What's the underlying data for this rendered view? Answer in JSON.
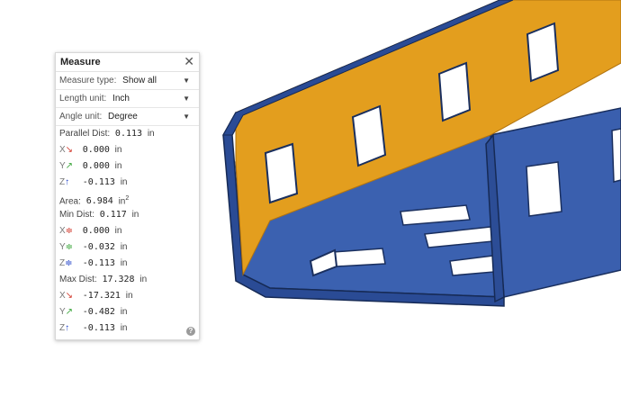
{
  "panel": {
    "title": "Measure",
    "close_icon": "close-icon",
    "measure_type": {
      "label": "Measure type:",
      "value": "Show all"
    },
    "length_unit": {
      "label": "Length unit:",
      "value": "Inch"
    },
    "angle_unit": {
      "label": "Angle unit:",
      "value": "Degree"
    },
    "parallel": {
      "label": "Parallel Dist:",
      "value": "0.113",
      "unit": "in",
      "x": {
        "axis": "X",
        "value": "0.000",
        "unit": "in"
      },
      "y": {
        "axis": "Y",
        "value": "0.000",
        "unit": "in"
      },
      "z": {
        "axis": "Z",
        "value": "-0.113",
        "unit": "in"
      }
    },
    "area": {
      "label": "Area:",
      "value": "6.984",
      "unit": "in",
      "sup": "2"
    },
    "min": {
      "label": "Min Dist:",
      "value": "0.117",
      "unit": "in",
      "x": {
        "axis": "X",
        "value": "0.000",
        "unit": "in"
      },
      "y": {
        "axis": "Y",
        "value": "-0.032",
        "unit": "in"
      },
      "z": {
        "axis": "Z",
        "value": "-0.113",
        "unit": "in"
      }
    },
    "max": {
      "label": "Max Dist:",
      "value": "17.328",
      "unit": "in",
      "x": {
        "axis": "X",
        "value": "-17.321",
        "unit": "in"
      },
      "y": {
        "axis": "Y",
        "value": "-0.482",
        "unit": "in"
      },
      "z": {
        "axis": "Z",
        "value": "-0.113",
        "unit": "in"
      }
    },
    "help_icon": "help-icon",
    "help_glyph": "?"
  },
  "colors": {
    "part_blue": "#3a5fae",
    "part_blue_dark": "#213f80",
    "selected_face": "#e39e1e",
    "x_axis": "#d23a2e",
    "y_axis": "#3aa53a",
    "z_axis": "#2445c8"
  }
}
